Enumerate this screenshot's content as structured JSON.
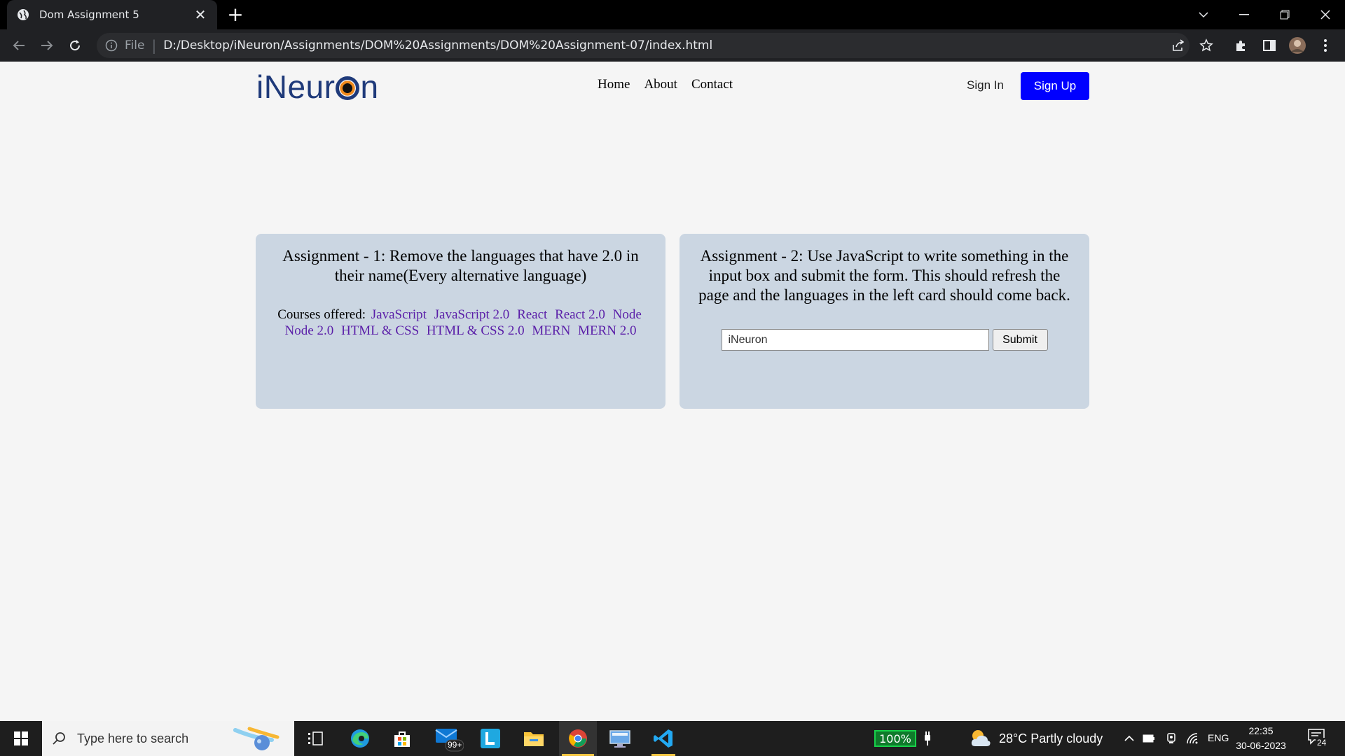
{
  "browser": {
    "tab_title": "Dom Assignment 5",
    "address_scheme": "File",
    "address_url": "D:/Desktop/iNeuron/Assignments/DOM%20Assignments/DOM%20Assignment-07/index.html"
  },
  "site": {
    "logo_text_pre": "iNeur",
    "logo_text_post": "n",
    "nav": [
      "Home",
      "About",
      "Contact"
    ],
    "sign_in": "Sign In",
    "sign_up": "Sign Up"
  },
  "card1": {
    "heading": "Assignment - 1: Remove the languages that have 2.0 in their name(Every alternative language)",
    "courses_label": "Courses offered:",
    "courses": [
      "JavaScript",
      "JavaScript 2.0",
      "React",
      "React 2.0",
      "Node",
      "Node 2.0",
      "HTML & CSS",
      "HTML & CSS 2.0",
      "MERN",
      "MERN 2.0"
    ]
  },
  "card2": {
    "heading": "Assignment - 2: Use JavaScript to write something in the input box and submit the form. This should refresh the page and the languages in the left card should come back.",
    "input_value": "iNeuron",
    "submit_label": "Submit"
  },
  "taskbar": {
    "search_placeholder": "Type here to search",
    "mail_badge": "99+",
    "battery": "100%",
    "weather": "28°C  Partly cloudy",
    "language": "ENG",
    "time": "22:35",
    "date": "30-06-2023",
    "notifications": "24"
  },
  "colors": {
    "signup_bg": "#0000ff",
    "card_bg": "#cbd6e2",
    "course_link": "#5a1ea8",
    "logo": "#1f3a7a"
  }
}
